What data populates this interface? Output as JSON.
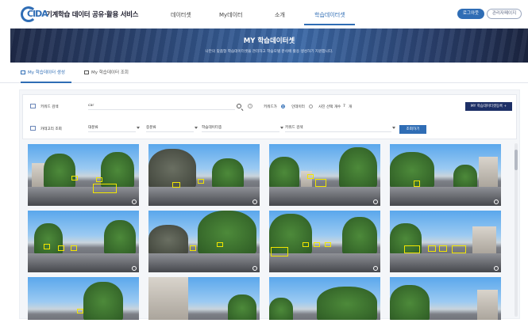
{
  "header": {
    "logo_mark": "ĈIDA",
    "logo_text": "기계학습 데이터 공유·활용 서비스",
    "nav": [
      "데이터셋",
      "My데이터",
      "소개",
      "학습데이터셋"
    ],
    "login_label": "로그아웃",
    "admin_label": "관리자페이지"
  },
  "banner": {
    "title": "MY 학습데이터셋",
    "subtitle": "나만의 맞춤형 학습데이터셋을 관리하고 학습모델 분석에 활용 생성하기 지원합니다."
  },
  "tabs": [
    "My 학습데이터 생성",
    "My 학습데이터 조회"
  ],
  "search": {
    "keyword_label": "키워드 검색",
    "keyword_value": "car",
    "option_label1": "키워드가",
    "option_label2": "인데이터",
    "option_label3": "사진 선택 개수",
    "count_value": "7",
    "count_unit": "개",
    "register_button": "MY 학습데이터셋등록 +",
    "category_label": "카테고리 조회",
    "selects": [
      "대분류",
      "중분류",
      "학습데이터종",
      "키워드 검색"
    ],
    "search_button": "조회하기"
  },
  "colors": {
    "accent": "#2f6db5",
    "dark_button": "#1d2f66",
    "bbox": "#f2e600"
  }
}
